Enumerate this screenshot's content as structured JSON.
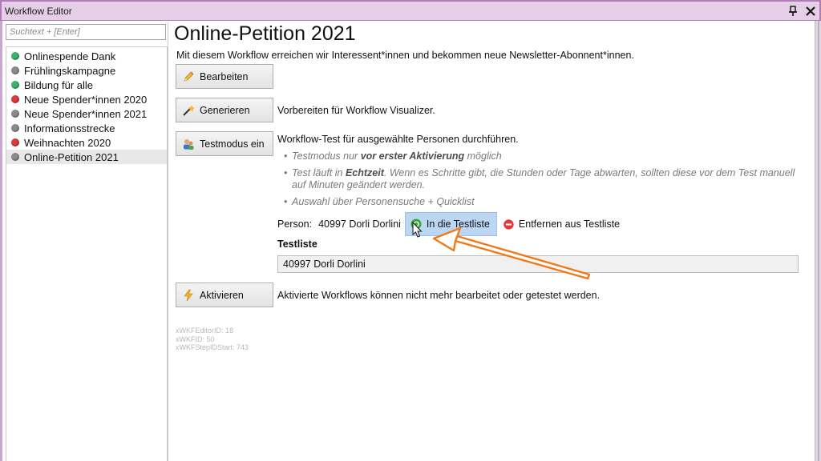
{
  "window": {
    "title": "Workflow Editor"
  },
  "search": {
    "placeholder": "Suchtext + [Enter]"
  },
  "sidebar": {
    "items": [
      {
        "label": "Onlinespende Dank",
        "status_color": "#3cb371",
        "status": "active"
      },
      {
        "label": "Frühlingskampagne",
        "status_color": "#8c8c8c",
        "status": "inactive"
      },
      {
        "label": "Bildung für alle",
        "status_color": "#3cb371",
        "status": "active"
      },
      {
        "label": "Neue Spender*innen 2020",
        "status_color": "#e03a3a",
        "status": "stopped"
      },
      {
        "label": "Neue Spender*innen 2021",
        "status_color": "#8c8c8c",
        "status": "inactive"
      },
      {
        "label": "Informationsstrecke",
        "status_color": "#8c8c8c",
        "status": "inactive"
      },
      {
        "label": "Weihnachten 2020",
        "status_color": "#e03a3a",
        "status": "stopped"
      },
      {
        "label": "Online-Petition 2021",
        "status_color": "#8c8c8c",
        "status": "inactive",
        "selected": true
      }
    ]
  },
  "main": {
    "title": "Online-Petition 2021",
    "subtitle": "Mit diesem Workflow erreichen wir Interessent*innen und bekommen neue Newsletter-Abonnent*innen.",
    "edit_label": "Bearbeiten",
    "generate_label": "Generieren",
    "generate_desc": "Vorbereiten für Workflow Visualizer.",
    "testmode_label": "Testmodus ein",
    "testmode_desc": "Workflow-Test für ausgewählte Personen durchführen.",
    "bullet1_pre": "Testmodus nur ",
    "bullet1_bold": "vor erster Aktivierung",
    "bullet1_post": " möglich",
    "bullet2_pre": "Test läuft in ",
    "bullet2_bold": "Echtzeit",
    "bullet2_post": ". Wenn es Schritte gibt, die Stunden oder Tage abwarten, sollten diese vor dem Test manuell auf Minuten geändert werden.",
    "bullet3": "Auswahl über Personensuche + Quicklist",
    "person_label": "Person:",
    "person_value": "40997 Dorli Dorlini",
    "add_label": "In die Testliste",
    "remove_label": "Entfernen aus Testliste",
    "testliste_label": "Testliste",
    "testliste_entry": "40997 Dorli Dorlini",
    "activate_label": "Aktivieren",
    "activate_desc": "Aktivierte Workflows können nicht mehr bearbeitet oder getestet werden.",
    "meta_editor": "xWKFEditorID: 18",
    "meta_wkf": "xWKFID: 50",
    "meta_step": "xWKFStepIDStart: 743"
  }
}
